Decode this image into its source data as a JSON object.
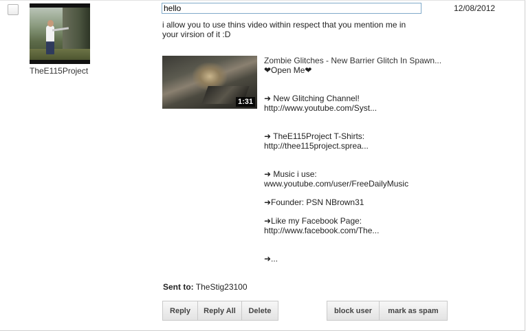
{
  "message": {
    "sender": "TheE115Project",
    "subject_value": "hello",
    "date": "12/08/2012",
    "body": "i allow you to use thins video within respect that you mention me in your virsion of it :D",
    "video": {
      "duration": "1:31",
      "title": "Zombie Glitches - New Barrier Glitch In Spawn...",
      "description": {
        "open_me": "❤Open Me❤",
        "channel_label": "➜ New Glitching Channel!",
        "channel_url": "http://www.youtube.com/Syst...",
        "shirts_label": "➜ TheE115Project T-Shirts:",
        "shirts_url": "http://thee115project.sprea...",
        "music_label": "➜ Music i use:",
        "music_url": "www.youtube.com/user/FreeDailyMusic",
        "founder": "➜Founder: PSN NBrown31",
        "facebook_label": "➜Like my Facebook Page:",
        "facebook_url": "http://www.facebook.com/The...",
        "more": "➜..."
      }
    },
    "sent_to_label": "Sent to:",
    "sent_to_value": "TheStig23100"
  },
  "actions": {
    "reply": "Reply",
    "reply_all": "Reply All",
    "delete": "Delete",
    "block_user": "block user",
    "mark_spam": "mark as spam"
  },
  "colors": {
    "subject_border": "#7fa9c9",
    "button_bg": "#e9e9e9",
    "heart": "#c0392b"
  }
}
